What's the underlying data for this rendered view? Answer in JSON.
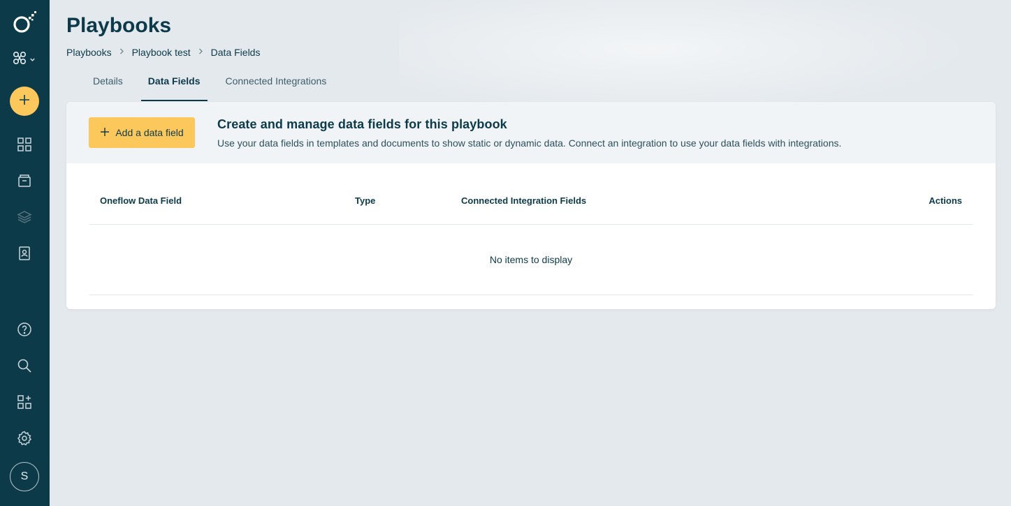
{
  "sidebar": {
    "avatar_initial": "S",
    "icons": [
      "oneflow-logo-icon",
      "workspace-icon",
      "plus-icon",
      "dashboard-icon",
      "documents-icon",
      "templates-icon",
      "address-book-icon",
      "help-icon",
      "search-icon",
      "marketplace-icon",
      "gear-icon"
    ]
  },
  "page": {
    "title": "Playbooks"
  },
  "breadcrumb": [
    "Playbooks",
    "Playbook test",
    "Data Fields"
  ],
  "tabs": [
    {
      "label": "Details",
      "active": false
    },
    {
      "label": "Data Fields",
      "active": true
    },
    {
      "label": "Connected Integrations",
      "active": false
    }
  ],
  "card": {
    "add_button_label": "Add a data field",
    "title": "Create and manage data fields for this playbook",
    "description": "Use your data fields in templates and documents to show static or dynamic data. Connect an integration to use your data fields with integrations."
  },
  "table": {
    "columns": [
      "Oneflow Data Field",
      "Type",
      "Connected Integration Fields",
      "Actions"
    ],
    "empty_text": "No items to display"
  },
  "colors": {
    "sidebar": "#0d3a48",
    "accent": "#fcc85c",
    "text": "#0c3a4a"
  }
}
